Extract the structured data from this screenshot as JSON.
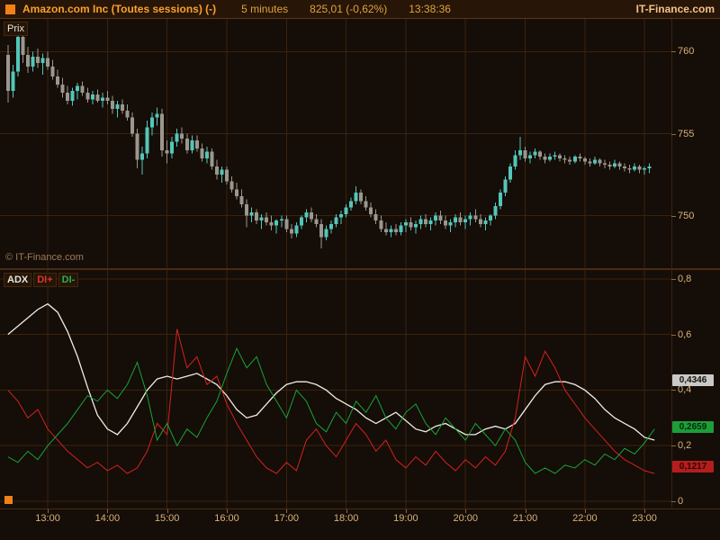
{
  "header": {
    "title": "Amazon.com Inc (Toutes sessions) (-)",
    "timeframe": "5 minutes",
    "price": "825,01 (-0,62%)",
    "clock": "13:38:36",
    "brand": "IT-Finance.com"
  },
  "price_panel": {
    "label": "Prix",
    "watermark": "© IT-Finance.com",
    "axis": [
      {
        "text": "760",
        "value": 760
      },
      {
        "text": "755",
        "value": 755
      },
      {
        "text": "750",
        "value": 750
      }
    ]
  },
  "adx_panel": {
    "legend": [
      {
        "label": "ADX",
        "color": "#e9e5db"
      },
      {
        "label": "DI+",
        "color": "#e23333"
      },
      {
        "label": "DI-",
        "color": "#2fae4e"
      }
    ],
    "axis": [
      {
        "text": "0,8",
        "value": 0.8
      },
      {
        "text": "0,6",
        "value": 0.6
      },
      {
        "text": "0,4",
        "value": 0.4
      },
      {
        "text": "0,2",
        "value": 0.2
      },
      {
        "text": "0",
        "value": 0
      }
    ],
    "badges": [
      {
        "text": "0,4346",
        "value": 0.4346,
        "color": "#c9c9c9",
        "text_color": "#18120a"
      },
      {
        "text": "0,2659",
        "value": 0.2659,
        "color": "#1d9e38",
        "text_color": "#06280e"
      },
      {
        "text": "0,1217",
        "value": 0.1217,
        "color": "#b51d1d",
        "text_color": "#2b0606"
      }
    ]
  },
  "time_axis": {
    "labels": [
      "13:00",
      "14:00",
      "15:00",
      "16:00",
      "17:00",
      "18:00",
      "19:00",
      "20:00",
      "21:00",
      "22:00",
      "23:00"
    ]
  },
  "time_range": {
    "start_hour": 12.2,
    "end_hour": 23.45
  },
  "colors": {
    "background": "#150d07",
    "grid": "#3a220e",
    "axis_text": "#d9b27c",
    "accent_orange": "#f08018"
  },
  "chart_data": [
    {
      "type": "candlestick",
      "title": "Prix",
      "x_start_hour": 12.3333,
      "x_step_hours": 0.08333,
      "ylim": [
        746.8,
        762.0
      ],
      "gridlines_y": [
        750,
        755,
        760
      ],
      "up_color": "#53c6ba",
      "down_color": "#9a978f",
      "candles": [
        [
          759.8,
          760.4,
          756.9,
          757.6
        ],
        [
          757.6,
          759.2,
          757.2,
          758.8
        ],
        [
          758.8,
          761.4,
          758.5,
          760.9
        ],
        [
          760.9,
          761.2,
          759.3,
          759.8
        ],
        [
          759.8,
          760.3,
          758.7,
          759.1
        ],
        [
          759.1,
          760.0,
          758.8,
          759.7
        ],
        [
          759.7,
          760.2,
          759.0,
          759.3
        ],
        [
          759.3,
          759.9,
          758.6,
          759.6
        ],
        [
          759.6,
          760.0,
          758.9,
          759.1
        ],
        [
          759.1,
          759.5,
          758.3,
          758.5
        ],
        [
          758.5,
          758.9,
          757.8,
          758.0
        ],
        [
          758.0,
          758.4,
          757.2,
          757.5
        ],
        [
          757.5,
          757.9,
          756.8,
          757.0
        ],
        [
          757.0,
          757.8,
          756.7,
          757.6
        ],
        [
          757.6,
          758.1,
          757.1,
          757.9
        ],
        [
          757.9,
          758.2,
          757.3,
          757.5
        ],
        [
          757.5,
          757.8,
          756.9,
          757.1
        ],
        [
          757.1,
          757.6,
          756.8,
          757.4
        ],
        [
          757.4,
          757.7,
          756.9,
          757.0
        ],
        [
          757.0,
          757.5,
          756.6,
          757.2
        ],
        [
          757.2,
          757.6,
          756.8,
          757.0
        ],
        [
          757.0,
          757.3,
          756.2,
          756.5
        ],
        [
          756.5,
          757.0,
          756.0,
          756.8
        ],
        [
          756.8,
          757.1,
          756.2,
          756.4
        ],
        [
          756.4,
          756.8,
          755.8,
          756.0
        ],
        [
          756.0,
          756.3,
          754.8,
          755.0
        ],
        [
          755.0,
          755.3,
          752.9,
          753.4
        ],
        [
          753.4,
          754.2,
          752.5,
          753.8
        ],
        [
          753.8,
          755.8,
          753.5,
          755.4
        ],
        [
          755.4,
          756.3,
          754.9,
          756.0
        ],
        [
          756.0,
          756.6,
          755.5,
          756.2
        ],
        [
          756.2,
          756.5,
          753.6,
          754.0
        ],
        [
          754.0,
          754.6,
          753.2,
          753.8
        ],
        [
          753.8,
          754.8,
          753.5,
          754.5
        ],
        [
          754.5,
          755.3,
          754.2,
          755.0
        ],
        [
          755.0,
          755.4,
          754.4,
          754.7
        ],
        [
          754.7,
          755.0,
          753.8,
          754.0
        ],
        [
          754.0,
          754.9,
          753.8,
          754.6
        ],
        [
          754.6,
          754.9,
          753.9,
          754.1
        ],
        [
          754.1,
          754.4,
          753.3,
          753.5
        ],
        [
          753.5,
          754.2,
          753.2,
          753.9
        ],
        [
          753.9,
          754.1,
          752.8,
          753.0
        ],
        [
          753.0,
          753.4,
          752.2,
          752.5
        ],
        [
          752.5,
          753.0,
          752.0,
          752.8
        ],
        [
          752.8,
          753.0,
          751.9,
          752.1
        ],
        [
          752.1,
          752.4,
          751.4,
          751.6
        ],
        [
          751.6,
          752.0,
          751.0,
          751.2
        ],
        [
          751.2,
          751.6,
          750.5,
          750.7
        ],
        [
          750.7,
          751.0,
          749.3,
          750.0
        ],
        [
          750.0,
          750.5,
          749.6,
          750.2
        ],
        [
          750.2,
          750.4,
          749.5,
          749.7
        ],
        [
          749.7,
          750.1,
          749.2,
          749.9
        ],
        [
          749.9,
          750.2,
          749.4,
          749.6
        ],
        [
          749.6,
          750.0,
          749.1,
          749.4
        ],
        [
          749.4,
          749.8,
          748.9,
          749.7
        ],
        [
          749.7,
          750.0,
          749.3,
          749.8
        ],
        [
          749.8,
          750.0,
          749.0,
          749.2
        ],
        [
          749.2,
          749.5,
          748.6,
          748.9
        ],
        [
          748.9,
          749.6,
          748.7,
          749.4
        ],
        [
          749.4,
          750.0,
          749.2,
          749.9
        ],
        [
          749.9,
          750.4,
          749.6,
          750.2
        ],
        [
          750.2,
          750.5,
          749.6,
          749.8
        ],
        [
          749.8,
          750.1,
          749.3,
          749.5
        ],
        [
          749.5,
          749.8,
          748.0,
          748.7
        ],
        [
          748.7,
          749.4,
          748.5,
          749.2
        ],
        [
          749.2,
          749.7,
          748.9,
          749.5
        ],
        [
          749.5,
          750.1,
          749.3,
          749.9
        ],
        [
          749.9,
          750.3,
          749.5,
          750.1
        ],
        [
          750.1,
          750.7,
          749.9,
          750.5
        ],
        [
          750.5,
          751.1,
          750.3,
          750.9
        ],
        [
          750.9,
          751.8,
          750.7,
          751.4
        ],
        [
          751.4,
          751.6,
          750.7,
          750.9
        ],
        [
          750.9,
          751.2,
          750.3,
          750.5
        ],
        [
          750.5,
          750.8,
          749.9,
          750.1
        ],
        [
          750.1,
          750.4,
          749.5,
          749.7
        ],
        [
          749.7,
          750.0,
          749.0,
          749.2
        ],
        [
          749.2,
          749.6,
          748.8,
          749.0
        ],
        [
          749.0,
          749.4,
          748.7,
          749.2
        ],
        [
          749.2,
          749.5,
          748.8,
          749.0
        ],
        [
          749.0,
          749.6,
          748.8,
          749.4
        ],
        [
          749.4,
          749.8,
          749.0,
          749.6
        ],
        [
          749.6,
          749.9,
          749.1,
          749.3
        ],
        [
          749.3,
          749.7,
          748.9,
          749.5
        ],
        [
          749.5,
          750.0,
          749.2,
          749.8
        ],
        [
          749.8,
          750.1,
          749.3,
          749.5
        ],
        [
          749.5,
          749.9,
          749.1,
          749.7
        ],
        [
          749.7,
          750.2,
          749.4,
          750.0
        ],
        [
          750.0,
          750.3,
          749.5,
          749.7
        ],
        [
          749.7,
          750.0,
          749.2,
          749.4
        ],
        [
          749.4,
          749.8,
          749.0,
          749.6
        ],
        [
          749.6,
          750.1,
          749.3,
          749.9
        ],
        [
          749.9,
          750.2,
          749.4,
          749.6
        ],
        [
          749.6,
          750.0,
          749.2,
          749.8
        ],
        [
          749.8,
          750.2,
          749.4,
          750.0
        ],
        [
          750.0,
          750.4,
          749.6,
          749.8
        ],
        [
          749.8,
          750.1,
          749.3,
          749.5
        ],
        [
          749.5,
          749.9,
          749.1,
          749.7
        ],
        [
          749.7,
          750.1,
          749.4,
          750.0
        ],
        [
          750.0,
          750.8,
          749.8,
          750.6
        ],
        [
          750.6,
          751.6,
          750.4,
          751.4
        ],
        [
          751.4,
          752.4,
          751.2,
          752.2
        ],
        [
          752.2,
          753.2,
          752.0,
          753.0
        ],
        [
          753.0,
          754.0,
          752.8,
          753.7
        ],
        [
          753.7,
          754.8,
          753.4,
          754.0
        ],
        [
          754.0,
          754.2,
          753.3,
          753.5
        ],
        [
          753.5,
          753.9,
          753.2,
          753.7
        ],
        [
          753.7,
          754.1,
          753.5,
          753.9
        ],
        [
          753.9,
          754.0,
          753.4,
          753.6
        ],
        [
          753.6,
          753.8,
          753.2,
          753.4
        ],
        [
          753.4,
          753.8,
          753.3,
          753.6
        ],
        [
          753.6,
          753.9,
          753.4,
          753.7
        ],
        [
          753.7,
          753.8,
          753.3,
          753.5
        ],
        [
          753.5,
          753.7,
          753.2,
          753.4
        ],
        [
          753.4,
          753.6,
          753.1,
          753.3
        ],
        [
          753.3,
          753.7,
          753.2,
          753.6
        ],
        [
          753.6,
          753.8,
          753.3,
          753.5
        ],
        [
          753.5,
          753.6,
          753.1,
          753.3
        ],
        [
          753.3,
          753.5,
          753.0,
          753.2
        ],
        [
          753.2,
          753.6,
          753.1,
          753.4
        ],
        [
          753.4,
          753.5,
          753.0,
          753.2
        ],
        [
          753.2,
          753.4,
          752.9,
          753.1
        ],
        [
          753.1,
          753.3,
          752.8,
          753.0
        ],
        [
          753.0,
          753.4,
          752.9,
          753.2
        ],
        [
          753.2,
          753.3,
          752.8,
          753.0
        ],
        [
          753.0,
          753.2,
          752.7,
          752.9
        ],
        [
          752.9,
          753.1,
          752.6,
          752.8
        ],
        [
          752.8,
          753.2,
          752.7,
          753.0
        ],
        [
          753.0,
          753.1,
          752.6,
          752.8
        ],
        [
          752.8,
          753.0,
          752.5,
          752.9
        ],
        [
          752.9,
          753.2,
          752.6,
          753.0
        ]
      ]
    },
    {
      "type": "line",
      "title": "ADX / DI+ / DI-",
      "x_start_hour": 12.3333,
      "x_step_hours": 0.16667,
      "ylim": [
        0,
        0.832
      ],
      "gridlines_y": [
        0,
        0.2,
        0.4,
        0.6,
        0.8
      ],
      "series": [
        {
          "name": "ADX",
          "color": "#f0ede6",
          "values": [
            0.6,
            0.63,
            0.66,
            0.69,
            0.71,
            0.68,
            0.61,
            0.52,
            0.41,
            0.31,
            0.26,
            0.24,
            0.28,
            0.34,
            0.4,
            0.44,
            0.45,
            0.44,
            0.45,
            0.46,
            0.44,
            0.42,
            0.38,
            0.33,
            0.3,
            0.31,
            0.35,
            0.39,
            0.42,
            0.43,
            0.43,
            0.42,
            0.4,
            0.37,
            0.35,
            0.33,
            0.3,
            0.28,
            0.3,
            0.32,
            0.29,
            0.26,
            0.25,
            0.27,
            0.28,
            0.26,
            0.24,
            0.24,
            0.26,
            0.27,
            0.26,
            0.28,
            0.33,
            0.38,
            0.42,
            0.43,
            0.43,
            0.42,
            0.4,
            0.37,
            0.33,
            0.3,
            0.28,
            0.26,
            0.23,
            0.22
          ]
        },
        {
          "name": "DI+",
          "color": "#d42222",
          "values": [
            0.4,
            0.36,
            0.3,
            0.33,
            0.26,
            0.22,
            0.18,
            0.15,
            0.12,
            0.14,
            0.11,
            0.13,
            0.1,
            0.12,
            0.18,
            0.28,
            0.24,
            0.62,
            0.48,
            0.52,
            0.42,
            0.45,
            0.35,
            0.28,
            0.22,
            0.16,
            0.12,
            0.1,
            0.14,
            0.11,
            0.22,
            0.26,
            0.2,
            0.16,
            0.22,
            0.28,
            0.24,
            0.18,
            0.22,
            0.15,
            0.12,
            0.16,
            0.13,
            0.18,
            0.14,
            0.11,
            0.15,
            0.12,
            0.16,
            0.13,
            0.18,
            0.3,
            0.52,
            0.45,
            0.54,
            0.48,
            0.4,
            0.35,
            0.3,
            0.26,
            0.22,
            0.18,
            0.15,
            0.13,
            0.11,
            0.1
          ]
        },
        {
          "name": "DI-",
          "color": "#16a339",
          "values": [
            0.16,
            0.14,
            0.18,
            0.15,
            0.2,
            0.24,
            0.28,
            0.33,
            0.38,
            0.36,
            0.4,
            0.37,
            0.42,
            0.5,
            0.38,
            0.22,
            0.28,
            0.2,
            0.26,
            0.23,
            0.3,
            0.36,
            0.46,
            0.55,
            0.48,
            0.52,
            0.42,
            0.36,
            0.3,
            0.4,
            0.36,
            0.28,
            0.25,
            0.32,
            0.28,
            0.36,
            0.32,
            0.38,
            0.3,
            0.26,
            0.32,
            0.35,
            0.28,
            0.24,
            0.3,
            0.26,
            0.22,
            0.28,
            0.24,
            0.2,
            0.26,
            0.22,
            0.14,
            0.1,
            0.12,
            0.1,
            0.13,
            0.12,
            0.15,
            0.13,
            0.17,
            0.15,
            0.19,
            0.17,
            0.21,
            0.26
          ]
        }
      ]
    }
  ]
}
